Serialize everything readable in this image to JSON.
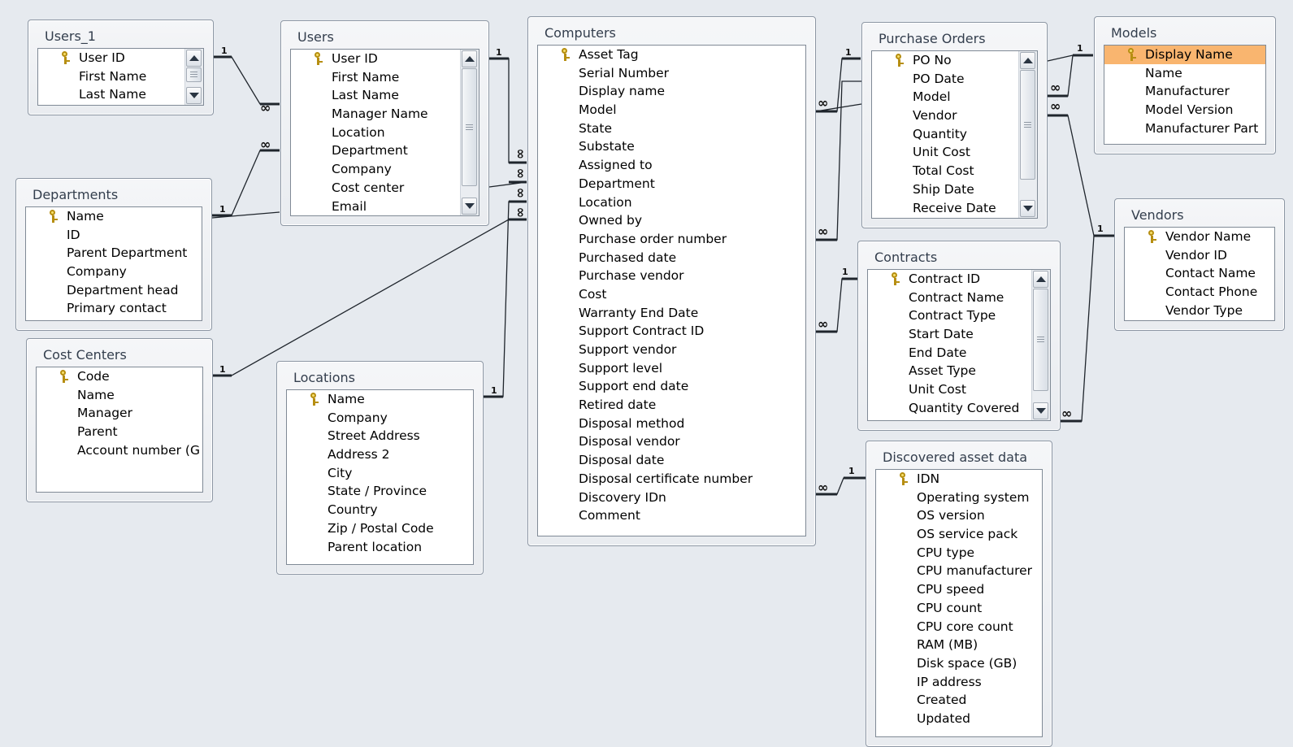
{
  "tables": [
    {
      "title": "Users_1",
      "fields": [
        {
          "name": "User ID",
          "key": true
        },
        {
          "name": "First Name"
        },
        {
          "name": "Last Name"
        }
      ]
    },
    {
      "title": "Users",
      "fields": [
        {
          "name": "User ID",
          "key": true
        },
        {
          "name": "First Name"
        },
        {
          "name": "Last Name"
        },
        {
          "name": "Manager Name"
        },
        {
          "name": "Location"
        },
        {
          "name": "Department"
        },
        {
          "name": "Company"
        },
        {
          "name": "Cost center"
        },
        {
          "name": "Email"
        }
      ]
    },
    {
      "title": "Computers",
      "fields": [
        {
          "name": "Asset Tag",
          "key": true
        },
        {
          "name": "Serial Number"
        },
        {
          "name": "Display name"
        },
        {
          "name": "Model"
        },
        {
          "name": "State"
        },
        {
          "name": "Substate"
        },
        {
          "name": "Assigned to"
        },
        {
          "name": "Department"
        },
        {
          "name": "Location"
        },
        {
          "name": "Owned by"
        },
        {
          "name": "Purchase order number"
        },
        {
          "name": "Purchased date"
        },
        {
          "name": "Purchase vendor"
        },
        {
          "name": "Cost"
        },
        {
          "name": "Warranty End Date"
        },
        {
          "name": "Support Contract ID"
        },
        {
          "name": "Support vendor"
        },
        {
          "name": "Support level"
        },
        {
          "name": "Support end date"
        },
        {
          "name": "Retired date"
        },
        {
          "name": "Disposal method"
        },
        {
          "name": "Disposal vendor"
        },
        {
          "name": "Disposal date"
        },
        {
          "name": "Disposal certificate number"
        },
        {
          "name": "Discovery IDn"
        },
        {
          "name": "Comment"
        }
      ]
    },
    {
      "title": "Purchase Orders",
      "fields": [
        {
          "name": "PO No",
          "key": true
        },
        {
          "name": "PO Date"
        },
        {
          "name": "Model"
        },
        {
          "name": "Vendor"
        },
        {
          "name": "Quantity"
        },
        {
          "name": "Unit Cost"
        },
        {
          "name": "Total Cost"
        },
        {
          "name": "Ship Date"
        },
        {
          "name": "Receive Date"
        }
      ]
    },
    {
      "title": "Models",
      "fields": [
        {
          "name": "Display Name",
          "key": true,
          "selected": true
        },
        {
          "name": "Name"
        },
        {
          "name": "Manufacturer"
        },
        {
          "name": "Model Version"
        },
        {
          "name": "Manufacturer Part"
        }
      ]
    },
    {
      "title": "Departments",
      "fields": [
        {
          "name": "Name",
          "key": true
        },
        {
          "name": "ID"
        },
        {
          "name": "Parent Department"
        },
        {
          "name": "Company"
        },
        {
          "name": "Department head"
        },
        {
          "name": "Primary contact"
        }
      ]
    },
    {
      "title": "Vendors",
      "fields": [
        {
          "name": "Vendor Name",
          "key": true
        },
        {
          "name": "Vendor ID"
        },
        {
          "name": "Contact Name"
        },
        {
          "name": "Contact Phone"
        },
        {
          "name": "Vendor Type"
        }
      ]
    },
    {
      "title": "Contracts",
      "fields": [
        {
          "name": "Contract ID",
          "key": true
        },
        {
          "name": "Contract Name"
        },
        {
          "name": "Contract Type"
        },
        {
          "name": "Start Date"
        },
        {
          "name": "End Date"
        },
        {
          "name": "Asset Type"
        },
        {
          "name": "Unit Cost"
        },
        {
          "name": "Quantity Covered"
        }
      ]
    },
    {
      "title": "Cost Centers",
      "fields": [
        {
          "name": "Code",
          "key": true
        },
        {
          "name": "Name"
        },
        {
          "name": "Manager"
        },
        {
          "name": "Parent"
        },
        {
          "name": "Account number (G"
        }
      ]
    },
    {
      "title": "Locations",
      "fields": [
        {
          "name": "Name",
          "key": true
        },
        {
          "name": "Company"
        },
        {
          "name": "Street Address"
        },
        {
          "name": "Address 2"
        },
        {
          "name": "City"
        },
        {
          "name": "State / Province"
        },
        {
          "name": "Country"
        },
        {
          "name": "Zip / Postal Code"
        },
        {
          "name": "Parent location"
        }
      ]
    },
    {
      "title": "Discovered asset data",
      "fields": [
        {
          "name": "IDN",
          "key": true
        },
        {
          "name": "Operating system"
        },
        {
          "name": "OS version"
        },
        {
          "name": "OS service pack"
        },
        {
          "name": "CPU type"
        },
        {
          "name": "CPU manufacturer"
        },
        {
          "name": "CPU speed"
        },
        {
          "name": "CPU count"
        },
        {
          "name": "CPU core count"
        },
        {
          "name": "RAM (MB)"
        },
        {
          "name": "Disk space (GB)"
        },
        {
          "name": "IP address"
        },
        {
          "name": "Created"
        },
        {
          "name": "Updated"
        }
      ]
    }
  ],
  "relationship_labels": {
    "one": "1",
    "many": "∞"
  },
  "colors": {
    "background": "#e6eaef",
    "selected_row": "#f9b56f",
    "key_icon": "#f6df6b"
  }
}
